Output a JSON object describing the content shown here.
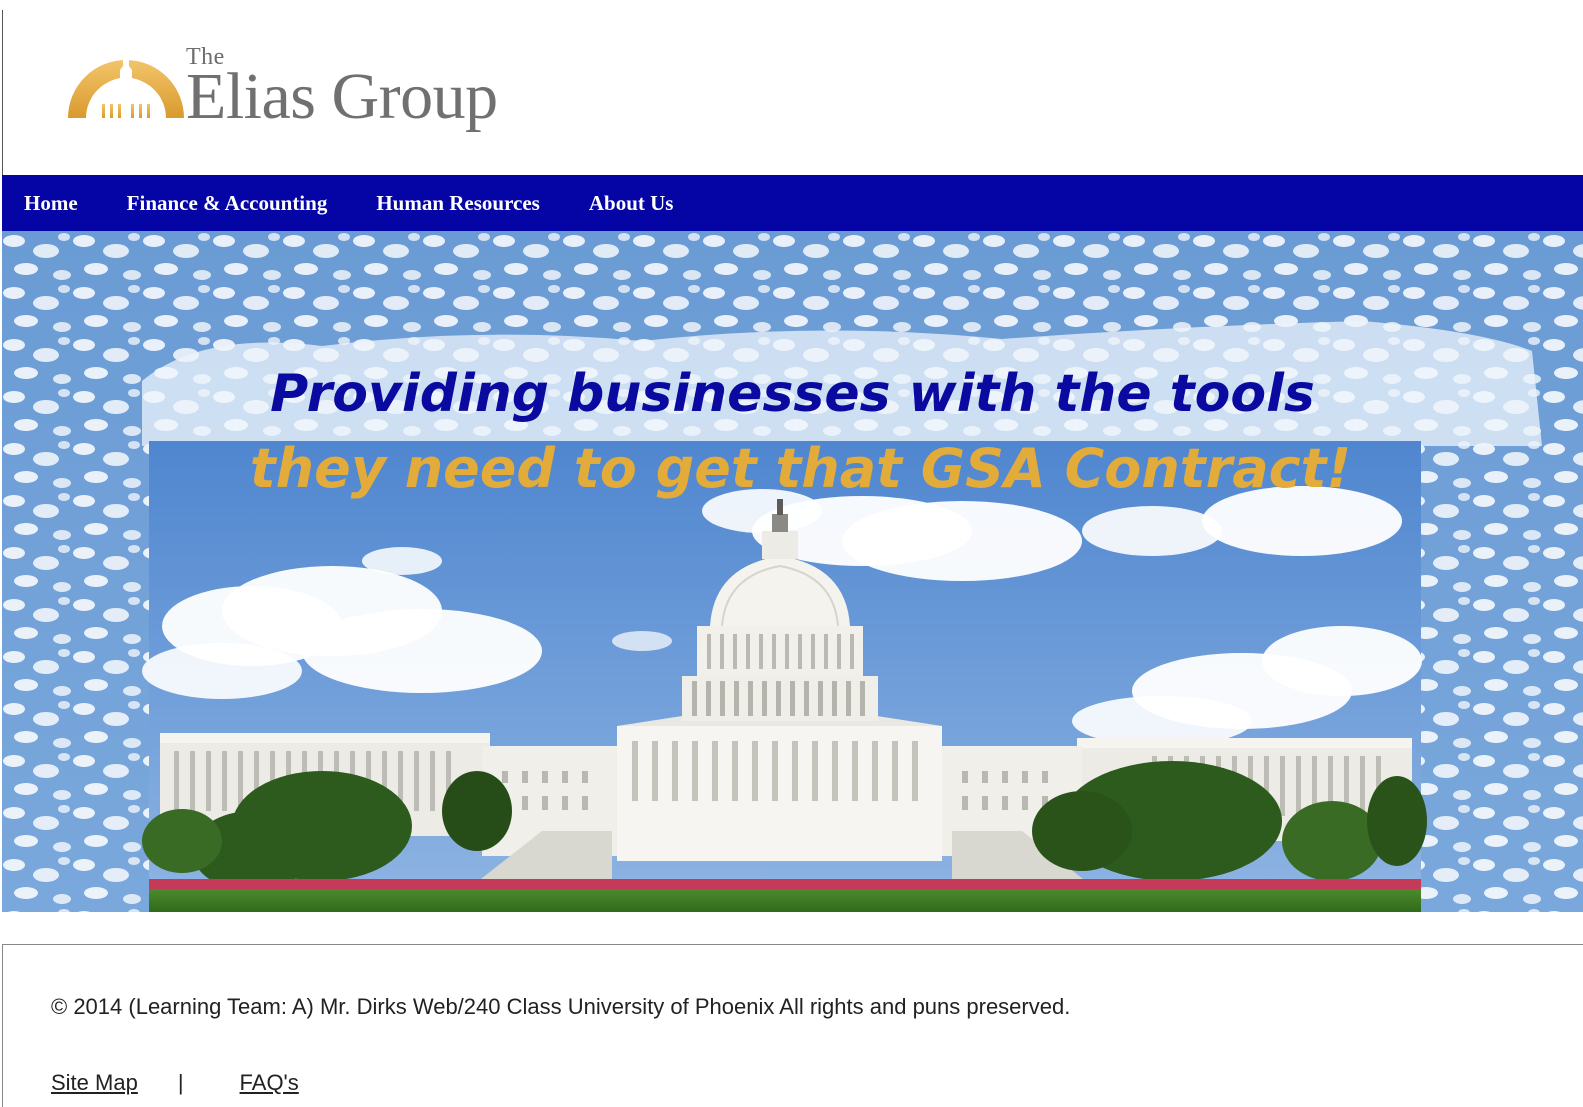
{
  "header": {
    "logo": {
      "the": "The",
      "name": "Elias Group",
      "icon": "capitol-dome-icon"
    }
  },
  "nav": {
    "items": [
      {
        "label": "Home"
      },
      {
        "label": "Finance & Accounting"
      },
      {
        "label": "Human Resources"
      },
      {
        "label": "About Us"
      }
    ]
  },
  "hero": {
    "headline_line1": "Providing businesses with the tools",
    "headline_line2": "they need to get that GSA Contract!",
    "image": "us-capitol-building-photo"
  },
  "footer": {
    "copyright": "© 2014 (Learning Team: A) Mr. Dirks Web/240 Class University of Phoenix All rights and puns preserved.",
    "links": [
      {
        "label": "Site Map"
      },
      {
        "label": "FAQ's"
      }
    ],
    "separator": "|"
  },
  "colors": {
    "nav_bg": "#0505a6",
    "headline_blue": "#0a0aa0",
    "headline_gold": "#e2ab3a",
    "logo_gold": "#e6ad45",
    "logo_gray": "#707070"
  }
}
